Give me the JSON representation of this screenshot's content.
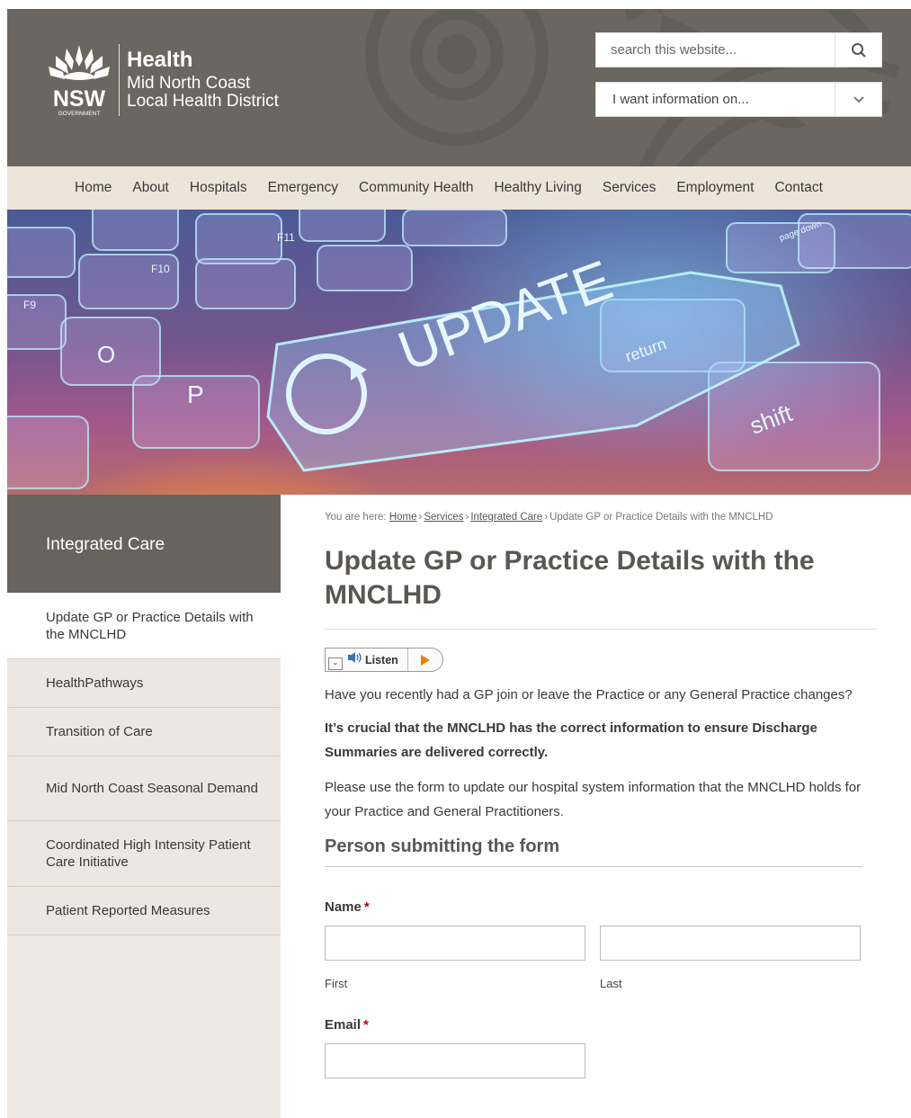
{
  "brand": {
    "line1": "Health",
    "line2": "Mid North Coast",
    "line3": "Local Health District",
    "nsw": "NSW",
    "gov": "GOVERNMENT"
  },
  "search": {
    "placeholder": "search this website..."
  },
  "info_select": {
    "selected": "I want information on..."
  },
  "nav": {
    "items": [
      "Home",
      "About",
      "Hospitals",
      "Emergency",
      "Community Health",
      "Healthy Living",
      "Services",
      "Employment",
      "Contact"
    ]
  },
  "hero": {
    "keys": [
      "F9",
      "F10",
      "F11",
      "O",
      "P",
      "shift",
      "return",
      "page down"
    ],
    "headline": "UPDATE"
  },
  "sidebar": {
    "heading": "Integrated Care",
    "items": [
      "Update GP or Practice Details with the MNCLHD",
      "HealthPathways",
      "Transition of Care",
      "Mid North Coast Seasonal Demand",
      "Coordinated High Intensity Patient Care Initiative",
      "Patient Reported Measures"
    ]
  },
  "breadcrumb": {
    "prefix": "You are here:",
    "links": [
      "Home",
      "Services",
      "Integrated Care"
    ],
    "separator": "›",
    "current": "Update GP or Practice Details with the MNCLHD"
  },
  "page": {
    "title": "Update GP or Practice Details with the MNCLHD",
    "listen_label": "Listen",
    "para1": "Have you recently had a GP join or leave the Practice or any General Practice changes?",
    "para2": "It’s crucial that the MNCLHD has the correct information to ensure Discharge Summaries are delivered correctly.",
    "para3": "Please use the form to update our hospital system information that the MNCLHD holds for your Practice and General Practitioners."
  },
  "form": {
    "section_title": "Person submitting the form",
    "name_label": "Name",
    "required_mark": "*",
    "first_label": "First",
    "last_label": "Last",
    "email_label": "Email"
  }
}
